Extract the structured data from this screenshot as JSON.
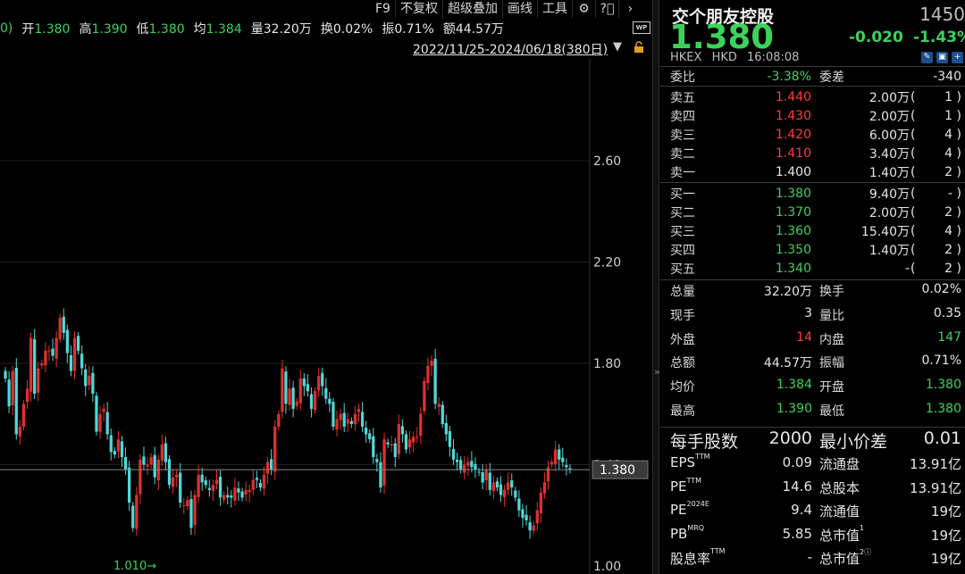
{
  "toolbar": {
    "items": [
      "F9",
      "不复权",
      "超级叠加",
      "画线",
      "工具"
    ],
    "icons": [
      "gear-icon",
      "help-icon",
      "chevron-right-icon"
    ]
  },
  "quote_line": {
    "prefix": "0)",
    "open_label": "开",
    "open": "1.380",
    "high_label": "高",
    "high": "1.390",
    "low_label": "低",
    "low": "1.380",
    "avg_label": "均",
    "avg": "1.384",
    "vol_label": "量",
    "vol": "32.20万",
    "turnover_label": "换",
    "turnover": "0.02%",
    "amp_label": "振",
    "amp": "0.71%",
    "amount_label": "额",
    "amount": "44.57万"
  },
  "wp_badge": "WP",
  "date_range": "2022/11/25-2024/06/18(380日)",
  "chart_data": {
    "type": "candlestick",
    "y_ticks": [
      "2.60",
      "2.20",
      "1.80",
      "1.40",
      "1.00"
    ],
    "ylim": [
      1.0,
      2.8
    ],
    "current_price": 1.38,
    "current_price_label": "1.380",
    "min_annotation": "1.010",
    "up_color": "#e0302e",
    "down_color": "#50d8d8",
    "closes": [
      1.74,
      1.63,
      1.77,
      1.52,
      1.55,
      1.64,
      1.7,
      1.9,
      1.68,
      1.78,
      1.8,
      1.85,
      1.85,
      1.83,
      1.9,
      1.98,
      1.92,
      1.84,
      1.77,
      1.9,
      1.85,
      1.78,
      1.71,
      1.75,
      1.68,
      1.53,
      1.6,
      1.62,
      1.52,
      1.45,
      1.44,
      1.5,
      1.43,
      1.38,
      1.25,
      1.15,
      1.28,
      1.42,
      1.4,
      1.4,
      1.43,
      1.35,
      1.42,
      1.48,
      1.41,
      1.32,
      1.35,
      1.36,
      1.25,
      1.24,
      1.26,
      1.15,
      1.28,
      1.36,
      1.33,
      1.32,
      1.3,
      1.32,
      1.34,
      1.27,
      1.28,
      1.27,
      1.27,
      1.31,
      1.29,
      1.27,
      1.3,
      1.3,
      1.34,
      1.34,
      1.31,
      1.36,
      1.41,
      1.38,
      1.55,
      1.6,
      1.78,
      1.64,
      1.7,
      1.62,
      1.65,
      1.74,
      1.71,
      1.69,
      1.62,
      1.69,
      1.75,
      1.71,
      1.66,
      1.64,
      1.55,
      1.58,
      1.6,
      1.55,
      1.58,
      1.56,
      1.6,
      1.62,
      1.55,
      1.52,
      1.5,
      1.43,
      1.41,
      1.31,
      1.5,
      1.48,
      1.48,
      1.43,
      1.56,
      1.52,
      1.46,
      1.5,
      1.51,
      1.51,
      1.6,
      1.73,
      1.79,
      1.81,
      1.64,
      1.64,
      1.56,
      1.52,
      1.47,
      1.42,
      1.41,
      1.38,
      1.4,
      1.41,
      1.39,
      1.38,
      1.37,
      1.33,
      1.38,
      1.3,
      1.33,
      1.31,
      1.28,
      1.3,
      1.33,
      1.31,
      1.27,
      1.22,
      1.19,
      1.18,
      1.14,
      1.16,
      1.22,
      1.29,
      1.33,
      1.39,
      1.41,
      1.46,
      1.42,
      1.41,
      1.39,
      1.38
    ]
  },
  "panel": {
    "name": "交个朋友控股",
    "code": "1450",
    "price": "1.380",
    "change": "-0.020",
    "change_pct": "-1.43%",
    "exchange": "HKEX",
    "currency": "HKD",
    "time": "16:08:08",
    "ratio_label": "委比",
    "ratio": "-3.38%",
    "diff_label": "委差",
    "diff": "-340",
    "asks": [
      {
        "label": "卖五",
        "price": "1.440",
        "vol": "2.00万",
        "cnt": "1"
      },
      {
        "label": "卖四",
        "price": "1.430",
        "vol": "2.00万",
        "cnt": "1"
      },
      {
        "label": "卖三",
        "price": "1.420",
        "vol": "6.00万",
        "cnt": "4"
      },
      {
        "label": "卖二",
        "price": "1.410",
        "vol": "3.40万",
        "cnt": "4"
      },
      {
        "label": "卖一",
        "price": "1.400",
        "vol": "1.40万",
        "cnt": "2"
      }
    ],
    "bids": [
      {
        "label": "买一",
        "price": "1.380",
        "vol": "9.40万",
        "cnt": "-"
      },
      {
        "label": "买二",
        "price": "1.370",
        "vol": "2.00万",
        "cnt": "2"
      },
      {
        "label": "买三",
        "price": "1.360",
        "vol": "15.40万",
        "cnt": "4"
      },
      {
        "label": "买四",
        "price": "1.350",
        "vol": "1.40万",
        "cnt": "2"
      },
      {
        "label": "买五",
        "price": "1.340",
        "vol": "-",
        "cnt": "2"
      }
    ],
    "stats": [
      {
        "k1": "总量",
        "v1": "32.20万",
        "k2": "换手",
        "v2": "0.02%"
      },
      {
        "k1": "现手",
        "v1": "3",
        "k2": "量比",
        "v2": "0.35"
      },
      {
        "k1": "外盘",
        "v1": "14",
        "k2": "内盘",
        "v2": "147"
      },
      {
        "k1": "总额",
        "v1": "44.57万",
        "k2": "振幅",
        "v2": "0.71%"
      },
      {
        "k1": "均价",
        "v1": "1.384",
        "k2": "开盘",
        "v2": "1.380"
      },
      {
        "k1": "最高",
        "v1": "1.390",
        "k2": "最低",
        "v2": "1.380"
      }
    ],
    "lot_label": "每手股数",
    "lot": "2000",
    "tick_label": "最小价差",
    "tick": "0.01",
    "fin": [
      {
        "k1": "EPS",
        "s1": "TTM",
        "v1": "0.09",
        "k2": "流通盘",
        "s2": "",
        "v2": "13.91亿"
      },
      {
        "k1": "PE",
        "s1": "TTM",
        "v1": "14.6",
        "k2": "总股本",
        "s2": "",
        "v2": "13.91亿"
      },
      {
        "k1": "PE",
        "s1": "2024E",
        "v1": "9.4",
        "k2": "流通值",
        "s2": "",
        "v2": "19亿"
      },
      {
        "k1": "PB",
        "s1": "MRQ",
        "v1": "5.85",
        "k2": "总市值",
        "s2": "1",
        "v2": "19亿"
      },
      {
        "k1": "股息率",
        "s1": "TTM",
        "v1": "-",
        "k2": "总市值",
        "s2": "2ⓘ",
        "v2": "19亿"
      }
    ]
  }
}
